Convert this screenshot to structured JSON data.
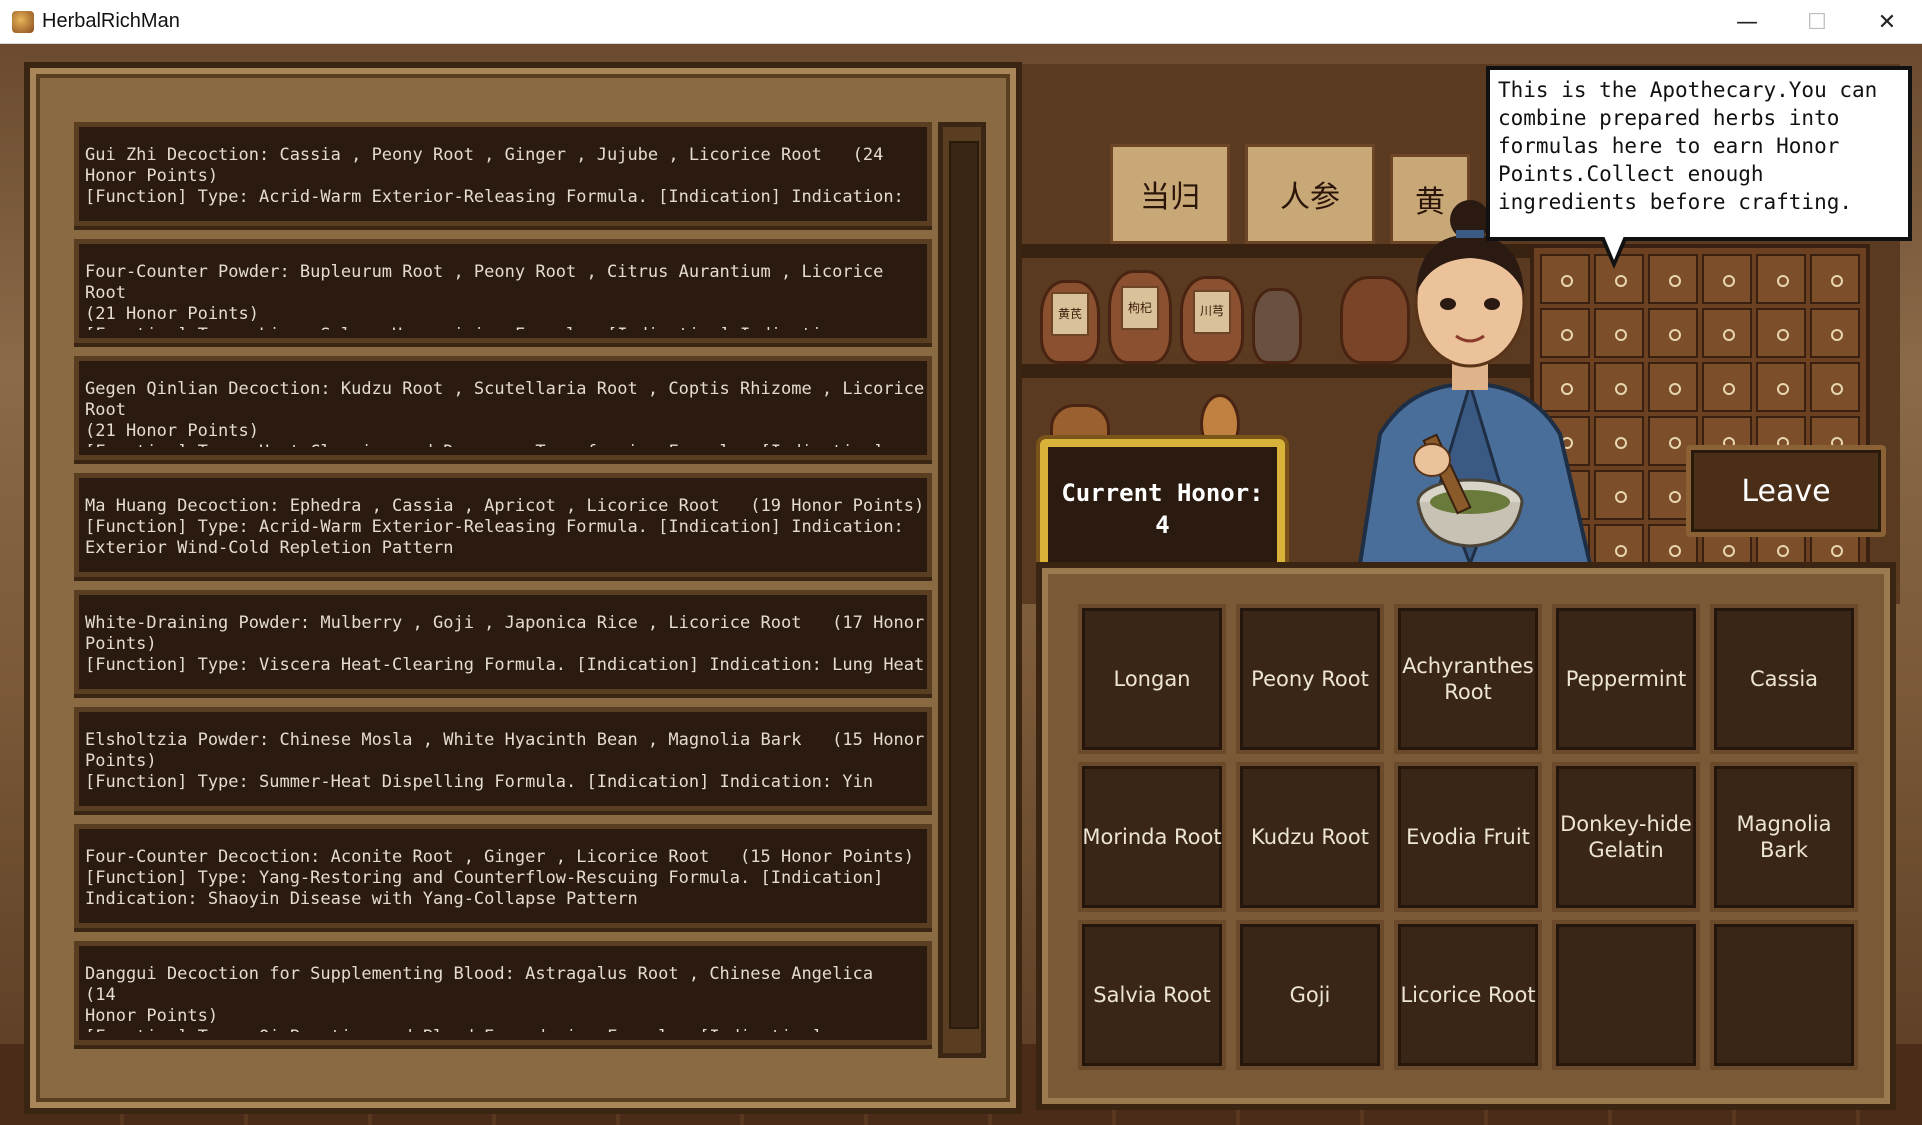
{
  "window": {
    "title": "HerbalRichMan",
    "minimize_glyph": "—",
    "maximize_glyph": "☐",
    "close_glyph": "✕"
  },
  "scene": {
    "box_labels": [
      "当归",
      "人参",
      "黄"
    ],
    "jar_labels": [
      "黄芪",
      "枸杞",
      "川芎"
    ]
  },
  "recipes": [
    {
      "text": "Gui Zhi Decoction: Cassia , Peony Root , Ginger , Jujube , Licorice Root   (24 Honor Points)\n[Function] Type: Acrid-Warm Exterior-Releasing Formula. [Indication] Indication:"
    },
    {
      "text": "Four-Counter Powder: Bupleurum Root , Peony Root , Citrus Aurantium , Licorice Root\n(21 Honor Points)\n[Function] Type: Liver-Spleen Harmonizing Formula. [Indication] Indication: Syncope"
    },
    {
      "text": "Gegen Qinlian Decoction: Kudzu Root , Scutellaria Root , Coptis Rhizome , Licorice Root\n(21 Honor Points)\n[Function] Type: Heat-Clearing and Dampness-Transforming Formula. [Indication]"
    },
    {
      "text": "Ma Huang Decoction: Ephedra , Cassia , Apricot , Licorice Root   (19 Honor Points)\n[Function] Type: Acrid-Warm Exterior-Releasing Formula. [Indication] Indication:\nExterior Wind-Cold Repletion Pattern"
    },
    {
      "text": "White-Draining Powder: Mulberry , Goji , Japonica Rice , Licorice Root   (17 Honor\nPoints)\n[Function] Type: Viscera Heat-Clearing Formula. [Indication] Indication: Lung Heat"
    },
    {
      "text": "Elsholtzia Powder: Chinese Mosla , White Hyacinth Bean , Magnolia Bark   (15 Honor\nPoints)\n[Function] Type: Summer-Heat Dispelling Formula. [Indication] Indication: Yin"
    },
    {
      "text": "Four-Counter Decoction: Aconite Root , Ginger , Licorice Root   (15 Honor Points)\n[Function] Type: Yang-Restoring and Counterflow-Rescuing Formula. [Indication]\nIndication: Shaoyin Disease with Yang-Collapse Pattern"
    },
    {
      "text": "Danggui Decoction for Supplementing Blood: Astragalus Root , Chinese Angelica   (14\nHonor Points)\n[Function] Type: Qi-Boosting and Blood-Engendering Formula. [Indication] Indication:"
    }
  ],
  "honor": {
    "label": "Current Honor:",
    "value": "4"
  },
  "leave_label": "Leave",
  "speech": "This is the Apothecary.You can combine prepared herbs into formulas here to earn Honor Points.Collect enough ingredients before crafting.",
  "herbs": [
    "Longan",
    "Peony Root",
    "Achyranthes Root",
    "Peppermint",
    "Cassia",
    "Morinda Root",
    "Kudzu Root",
    "Evodia Fruit",
    "Donkey-hide Gelatin",
    "Magnolia Bark",
    "Salvia Root",
    "Goji",
    "Licorice Root",
    "",
    ""
  ],
  "colors": {
    "honor_border": "#d9b23a",
    "panel_wood": "#8a6a42",
    "cell_dark": "#3a2616",
    "robe": "#4a6e9a"
  }
}
